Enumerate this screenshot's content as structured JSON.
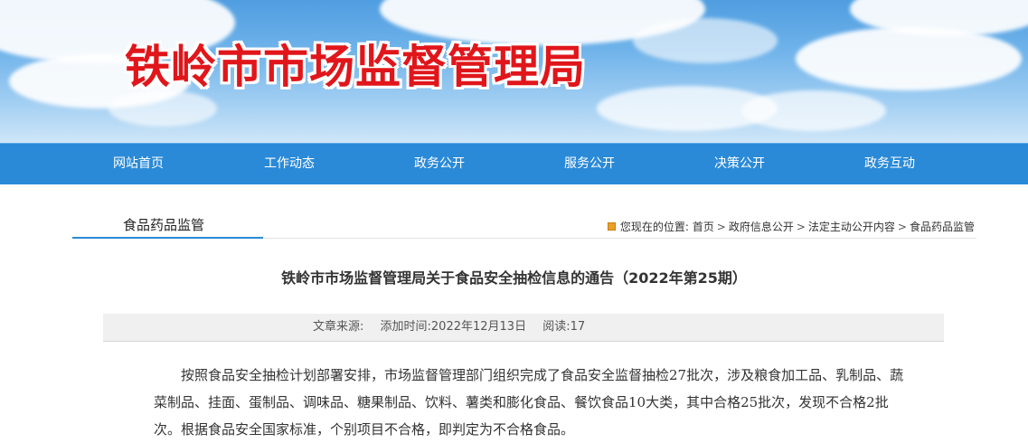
{
  "site": {
    "title": "铁岭市市场监督管理局"
  },
  "nav": {
    "items": [
      {
        "label": "网站首页"
      },
      {
        "label": "工作动态"
      },
      {
        "label": "政务公开"
      },
      {
        "label": "服务公开"
      },
      {
        "label": "决策公开"
      },
      {
        "label": "政务互动"
      }
    ]
  },
  "section": {
    "title": "食品药品监管"
  },
  "breadcrumb": {
    "prefix": "您现在的位置:",
    "items": [
      "首页",
      "政府信息公开",
      "法定主动公开内容",
      "食品药品监管"
    ],
    "separator": ">"
  },
  "article": {
    "title": "铁岭市市场监督管理局关于食品安全抽检信息的通告（2022年第25期）",
    "meta": {
      "source": "文章来源:",
      "date": "添加时间:2022年12月13日",
      "views": "阅读:17"
    },
    "body": "　　按照食品安全抽检计划部署安排，市场监督管理部门组织完成了食品安全监督抽检27批次，涉及粮食加工品、乳制品、蔬菜制品、挂面、蛋制品、调味品、糖果制品、饮料、薯类和膨化食品、餐饮食品10大类，其中合格25批次，发现不合格2批次。根据食品安全国家标准，个别项目不合格，即判定为不合格食品。"
  },
  "colors": {
    "accent": "#2a8ad8",
    "title_red": "#e0161b",
    "meta_bg": "#f0f0f0"
  }
}
